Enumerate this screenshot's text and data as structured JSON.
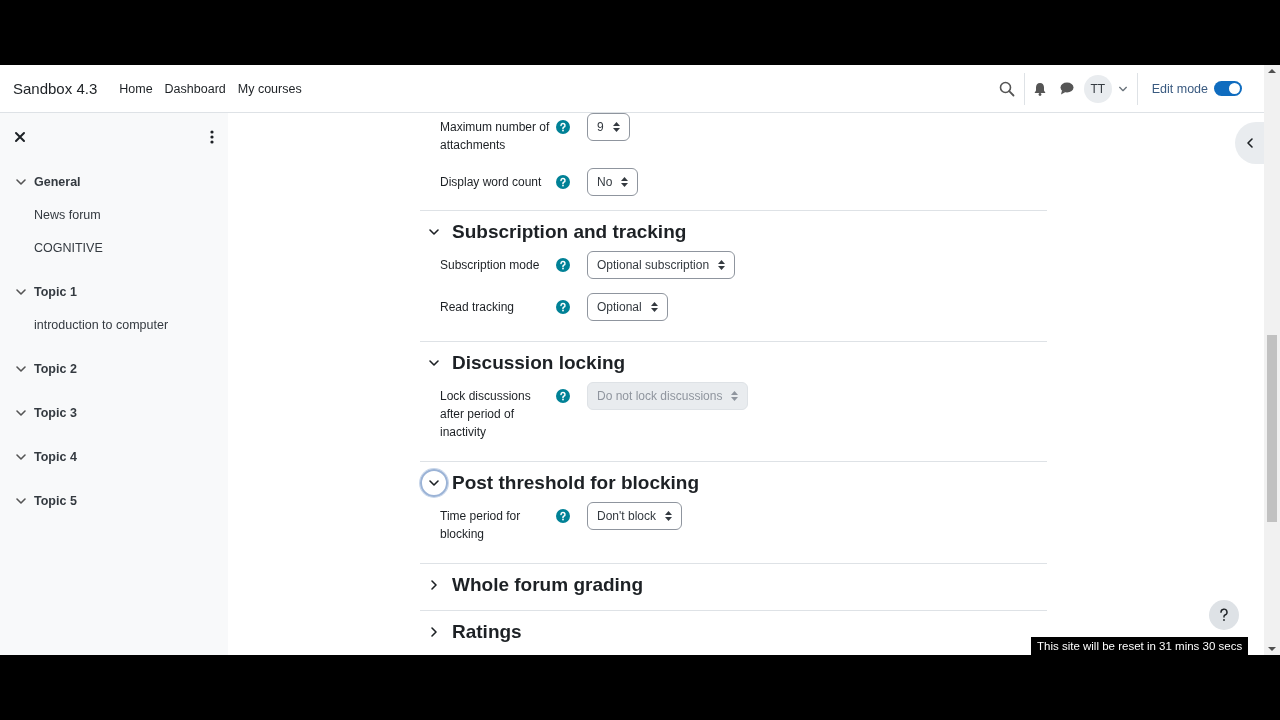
{
  "navbar": {
    "brand": "Sandbox 4.3",
    "links": [
      {
        "label": "Home"
      },
      {
        "label": "Dashboard"
      },
      {
        "label": "My courses"
      }
    ],
    "avatar": "TT",
    "edit_mode": {
      "label": "Edit mode",
      "on": true
    }
  },
  "sidebar": {
    "sections": [
      {
        "title": "General",
        "expanded": true,
        "children": [
          {
            "label": "News forum"
          },
          {
            "label": "COGNITIVE"
          }
        ]
      },
      {
        "title": "Topic 1",
        "expanded": true,
        "children": [
          {
            "label": "introduction to computer"
          }
        ]
      },
      {
        "title": "Topic 2",
        "expanded": true
      },
      {
        "title": "Topic 3",
        "expanded": true
      },
      {
        "title": "Topic 4",
        "expanded": true
      },
      {
        "title": "Topic 5",
        "expanded": true
      }
    ]
  },
  "form": {
    "leading_fields": [
      {
        "label": "Maximum number of attachments",
        "value": "9",
        "disabled": false
      },
      {
        "label": "Display word count",
        "value": "No",
        "disabled": false
      }
    ],
    "sections": [
      {
        "title": "Subscription and tracking",
        "expanded": true,
        "focused": false,
        "fields": [
          {
            "label": "Subscription mode",
            "value": "Optional subscription",
            "disabled": false
          },
          {
            "label": "Read tracking",
            "value": "Optional",
            "disabled": false
          }
        ]
      },
      {
        "title": "Discussion locking",
        "expanded": true,
        "focused": false,
        "fields": [
          {
            "label": "Lock discussions after period of inactivity",
            "value": "Do not lock discussions",
            "disabled": true
          }
        ]
      },
      {
        "title": "Post threshold for blocking",
        "expanded": true,
        "focused": true,
        "fields": [
          {
            "label": "Time period for blocking",
            "value": "Don't block",
            "disabled": false
          }
        ]
      },
      {
        "title": "Whole forum grading",
        "expanded": false,
        "focused": false
      },
      {
        "title": "Ratings",
        "expanded": false,
        "focused": false
      }
    ]
  },
  "reset_notice": "This site will be reset in 31 mins 30 secs"
}
